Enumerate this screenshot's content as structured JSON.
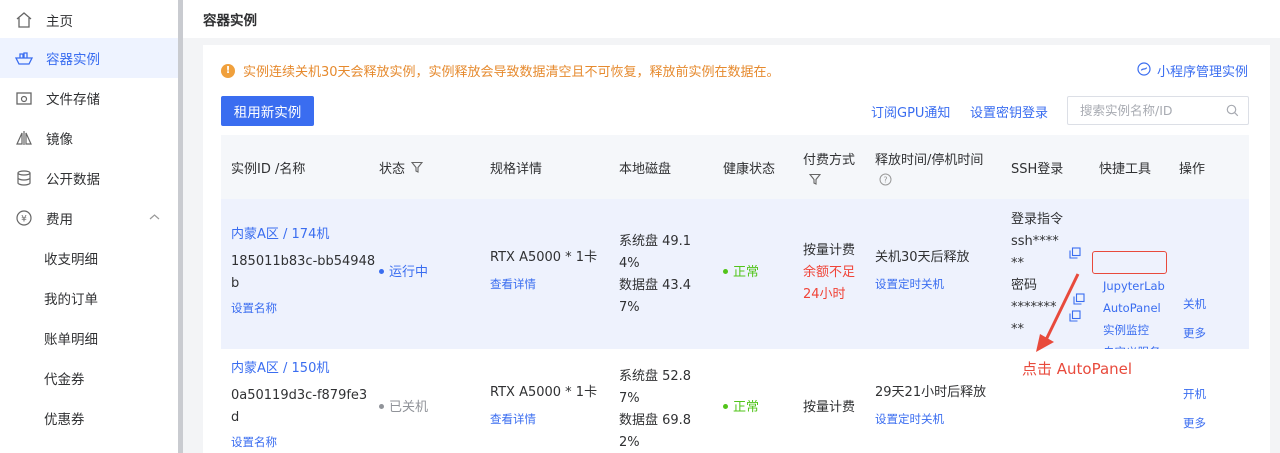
{
  "sidebar": {
    "items": [
      {
        "label": "主页",
        "icon": "home-icon"
      },
      {
        "label": "容器实例",
        "icon": "container-icon"
      },
      {
        "label": "文件存储",
        "icon": "storage-icon"
      },
      {
        "label": "镜像",
        "icon": "mirror-icon"
      },
      {
        "label": "公开数据",
        "icon": "database-icon"
      },
      {
        "label": "费用",
        "icon": "yen-icon"
      }
    ],
    "sub_items": [
      "收支明细",
      "我的订单",
      "账单明细",
      "代金券",
      "优惠券"
    ]
  },
  "header": {
    "title": "容器实例"
  },
  "notice": {
    "text": "实例连续关机30天会释放实例，实例释放会导致数据清空且不可恢复，释放前实例在数据在。",
    "mini_link": "小程序管理实例"
  },
  "toolbar": {
    "rent_label": "租用新实例",
    "subscribe_label": "订阅GPU通知",
    "key_label": "设置密钥登录",
    "search_placeholder": "搜索实例名称/ID"
  },
  "table": {
    "headers": {
      "id": "实例ID /名称",
      "status": "状态",
      "spec": "规格详情",
      "disk": "本地磁盘",
      "health": "健康状态",
      "pay": "付费方式",
      "release": "释放时间/停机时间",
      "ssh": "SSH登录",
      "tools": "快捷工具",
      "ops": "操作"
    },
    "rows": [
      {
        "region": "内蒙A区 / 174机",
        "id_line1": "185011b83c-bb54948",
        "id_line2": "b",
        "set_name": "设置名称",
        "status": "运行中",
        "spec": "RTX A5000 * 1卡",
        "spec_link": "查看详情",
        "disk_l1": "系统盘 49.1",
        "disk_l2": "4%",
        "disk_l3": "数据盘 43.4",
        "disk_l4": "7%",
        "health": "正常",
        "pay": "按量计费",
        "pay_warn_l1": "余额不足",
        "pay_warn_l2": "24小时",
        "release": "关机30天后释放",
        "release_link": "设置定时关机",
        "ssh_cmd_label": "登录指令",
        "ssh_cmd_l1": "ssh****",
        "ssh_cmd_l2": "**",
        "ssh_pwd_label": "密码",
        "ssh_pwd_l1": "*******",
        "ssh_pwd_l2": "**",
        "tools": [
          "JupyterLab",
          "AutoPanel",
          "实例监控",
          "自定义服务"
        ],
        "op_primary": "关机",
        "op_more": "更多"
      },
      {
        "region": "内蒙A区 / 150机",
        "id_line1": "0a50119d3c-f879fe3",
        "id_line2": "d",
        "set_name": "设置名称",
        "status": "已关机",
        "spec": "RTX A5000 * 1卡",
        "spec_link": "查看详情",
        "disk_l1": "系统盘 52.8",
        "disk_l2": "7%",
        "disk_l3": "数据盘 69.8",
        "disk_l4": "2%",
        "health": "正常",
        "pay": "按量计费",
        "release": "29天21小时后释放",
        "release_link": "设置定时关机",
        "op_primary": "开机",
        "op_more": "更多"
      }
    ]
  },
  "annotation": {
    "text": "点击 AutoPanel"
  },
  "colors": {
    "accent": "#3a6df0",
    "warning": "#e68a2e",
    "danger": "#f04438",
    "success": "#52c41a",
    "annotation": "#e84a3c"
  }
}
